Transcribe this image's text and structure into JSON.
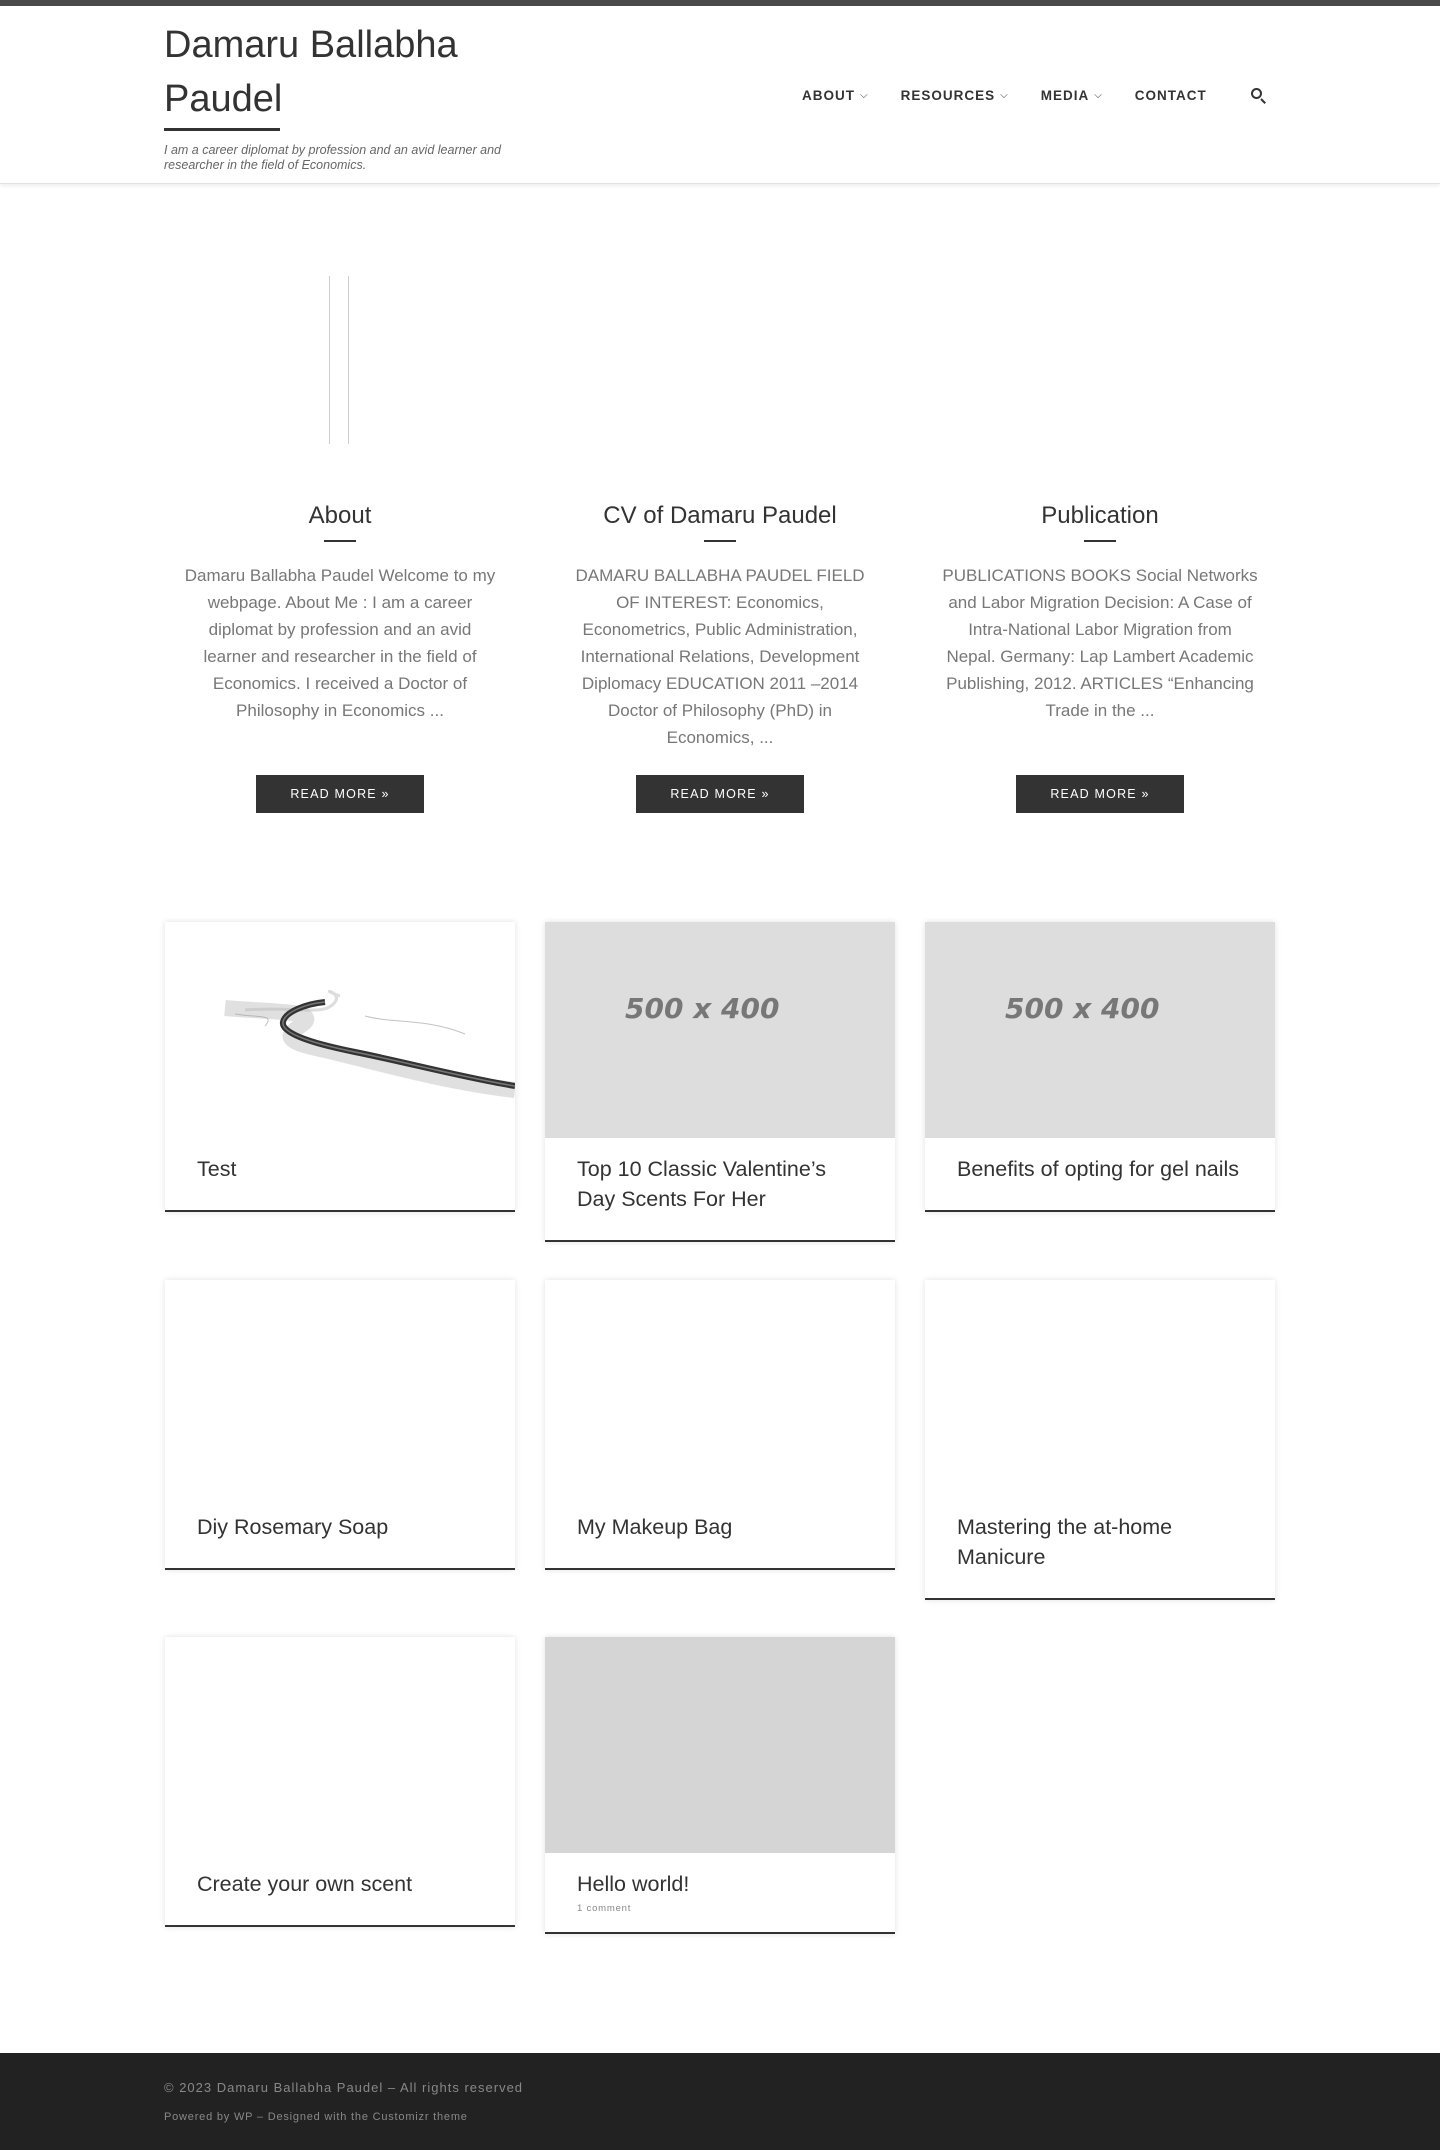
{
  "site": {
    "title": "Damaru Ballabha Paudel",
    "tagline": "I am a career diplomat by profession and an avid learner and researcher in the field of Economics."
  },
  "nav": {
    "items": [
      {
        "label": "ABOUT",
        "has_dropdown": true
      },
      {
        "label": "RESOURCES",
        "has_dropdown": true
      },
      {
        "label": "MEDIA",
        "has_dropdown": true
      },
      {
        "label": "CONTACT",
        "has_dropdown": false
      }
    ],
    "caret": "⌵",
    "search_icon": "search-icon"
  },
  "features": [
    {
      "title": "About",
      "excerpt": "Damaru Ballabha Paudel Welcome to my webpage. About Me : I am a career diplomat by profession and an avid learner and researcher in the field of Economics. I received a Doctor of Philosophy in Economics ...",
      "button": "READ MORE »"
    },
    {
      "title": "CV of Damaru Paudel",
      "excerpt": "DAMARU BALLABHA PAUDEL FIELD OF INTEREST: Economics, Econometrics, Public Administration, International Relations, Development Diplomacy EDUCATION 2011 –2014 Doctor of Philosophy (PhD) in Economics, ...",
      "button": "READ MORE »"
    },
    {
      "title": "Publication",
      "excerpt": "PUBLICATIONS BOOKS Social Networks and Labor Migration Decision: A Case of Intra-National Labor Migration from Nepal. Germany: Lap Lambert Academic Publishing, 2012. ARTICLES “Enhancing Trade in the ...",
      "button": "READ MORE »"
    }
  ],
  "posts": [
    {
      "title": "Test",
      "thumb": "road-image"
    },
    {
      "title": "Top 10 Classic Valentine’s Day Scents For Her",
      "thumb": "placeholder",
      "placeholder_text": "500 x 400"
    },
    {
      "title": "Benefits of opting for gel nails",
      "thumb": "placeholder",
      "placeholder_text": "500 x 400"
    },
    {
      "title": "Diy Rosemary Soap",
      "thumb": "blank"
    },
    {
      "title": "My Makeup Bag",
      "thumb": "blank"
    },
    {
      "title": "Mastering the at-home Manicure",
      "thumb": "blank"
    },
    {
      "title": "Create your own scent",
      "thumb": "blank"
    },
    {
      "title": "Hello world!",
      "thumb": "gray",
      "comments": "1 comment"
    }
  ],
  "footer": {
    "copyright": "© 2023 Damaru Ballabha Paudel – All rights reserved",
    "credits": "Powered by WP – Designed with the Customizr theme"
  },
  "colors": {
    "header_bar": "#4a4a4a",
    "button_bg": "#333333",
    "footer_bg": "#222222"
  }
}
